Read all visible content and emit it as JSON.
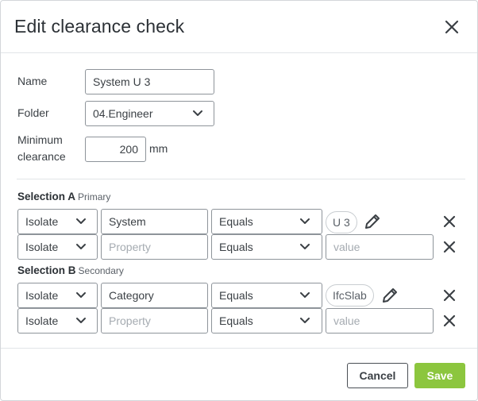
{
  "dialog": {
    "title": "Edit clearance check",
    "close_icon": "close-icon"
  },
  "form": {
    "name_label": "Name",
    "name_value": "System U 3",
    "folder_label": "Folder",
    "folder_value": "04.Engineer",
    "min_clearance_label_1": "Minimum",
    "min_clearance_label_2": "clearance",
    "min_clearance_value": "200",
    "min_clearance_unit": "mm"
  },
  "selection_a": {
    "title": "Selection A",
    "subtitle": "Primary",
    "rows": [
      {
        "mode": "Isolate",
        "property_value": "System",
        "property_placeholder": "Property",
        "operator": "Equals",
        "value_chip": "U 3",
        "value_placeholder": "value"
      },
      {
        "mode": "Isolate",
        "property_value": "",
        "property_placeholder": "Property",
        "operator": "Equals",
        "value_chip": "",
        "value_placeholder": "value"
      }
    ]
  },
  "selection_b": {
    "title": "Selection B",
    "subtitle": "Secondary",
    "rows": [
      {
        "mode": "Isolate",
        "property_value": "Category",
        "property_placeholder": "Property",
        "operator": "Equals",
        "value_chip": "IfcSlab",
        "value_placeholder": "value"
      },
      {
        "mode": "Isolate",
        "property_value": "",
        "property_placeholder": "Property",
        "operator": "Equals",
        "value_chip": "",
        "value_placeholder": "value"
      }
    ]
  },
  "footer": {
    "cancel_label": "Cancel",
    "save_label": "Save"
  },
  "colors": {
    "accent_save": "#8cc63e",
    "input_border": "#8e949a"
  }
}
